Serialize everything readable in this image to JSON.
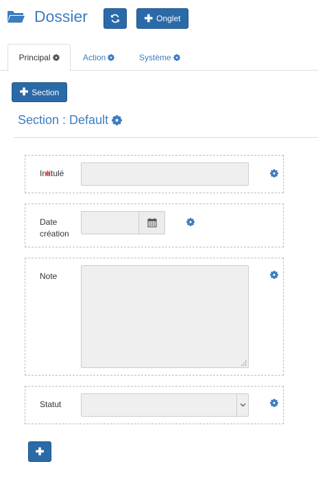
{
  "header": {
    "title": "Dossier",
    "tab_button_label": "Onglet"
  },
  "tabs": [
    {
      "label": "Principal",
      "active": true
    },
    {
      "label": "Action",
      "active": false
    },
    {
      "label": "Système",
      "active": false
    }
  ],
  "section_button_label": "Section",
  "section": {
    "title": "Section : Default"
  },
  "fields": {
    "intitule": {
      "label": "Intitulé",
      "value": "",
      "required": true
    },
    "date_creation": {
      "label_line1": "Date",
      "label_line2": "création",
      "value": ""
    },
    "note": {
      "label": "Note",
      "value": ""
    },
    "statut": {
      "label": "Statut",
      "value": ""
    }
  },
  "colors": {
    "accent": "#3c7dc0",
    "button": "#2b6aa8"
  }
}
